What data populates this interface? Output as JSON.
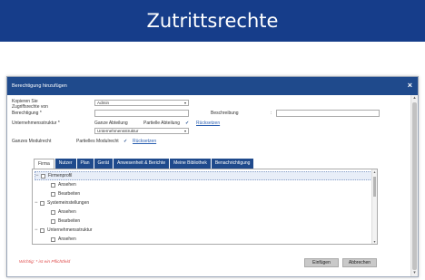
{
  "page": {
    "title": "Zutrittsrechte"
  },
  "dialog": {
    "title": "Berechtigung hinzufügen",
    "close_glyph": "×",
    "copy_label": "Kopieren Sie Zugriffsrechte von",
    "copy_value": "Admin",
    "permission_label": "Berechtigung *",
    "description_label": "Beschreibung",
    "description_colon": ":",
    "org_label": "Unternehmensstruktur *",
    "whole_dept": "Ganze Abteilung",
    "partial_dept": "Partielle Abteilung",
    "reset_1": "Rücksetzen",
    "org_select": "Unternehmensstruktur",
    "whole_module": "Ganzes Modulrecht",
    "partial_module": "Partielles Modulrecht",
    "reset_2": "Rücksetzen",
    "tabs": [
      "Firma",
      "Nutzer",
      "Plan",
      "Gerät",
      "Anwesenheit & Berichte",
      "Meine Bibliothek",
      "Benachrichtigung"
    ],
    "tree": [
      {
        "label": "Firmenprofil",
        "level": 0,
        "toggle": "−"
      },
      {
        "label": "Ansehen",
        "level": 1,
        "toggle": ""
      },
      {
        "label": "Bearbeiten",
        "level": 1,
        "toggle": ""
      },
      {
        "label": "Systemeinstellungen",
        "level": 0,
        "toggle": "−"
      },
      {
        "label": "Ansehen",
        "level": 1,
        "toggle": ""
      },
      {
        "label": "Bearbeiten",
        "level": 1,
        "toggle": ""
      },
      {
        "label": "Unternehmensstruktur",
        "level": 0,
        "toggle": "−"
      },
      {
        "label": "Ansehen",
        "level": 1,
        "toggle": ""
      }
    ],
    "required_note": "Wichtig: * ist ein Pflichtfeld",
    "save_label": "Einfügen",
    "cancel_label": "Abbrechen"
  },
  "colors": {
    "banner": "#163d8a",
    "header": "#1f4a8c",
    "tab": "#1f4a8c",
    "note": "#e05050"
  },
  "icons": {
    "check": "✓",
    "caret": "▾",
    "close": "close-icon"
  }
}
